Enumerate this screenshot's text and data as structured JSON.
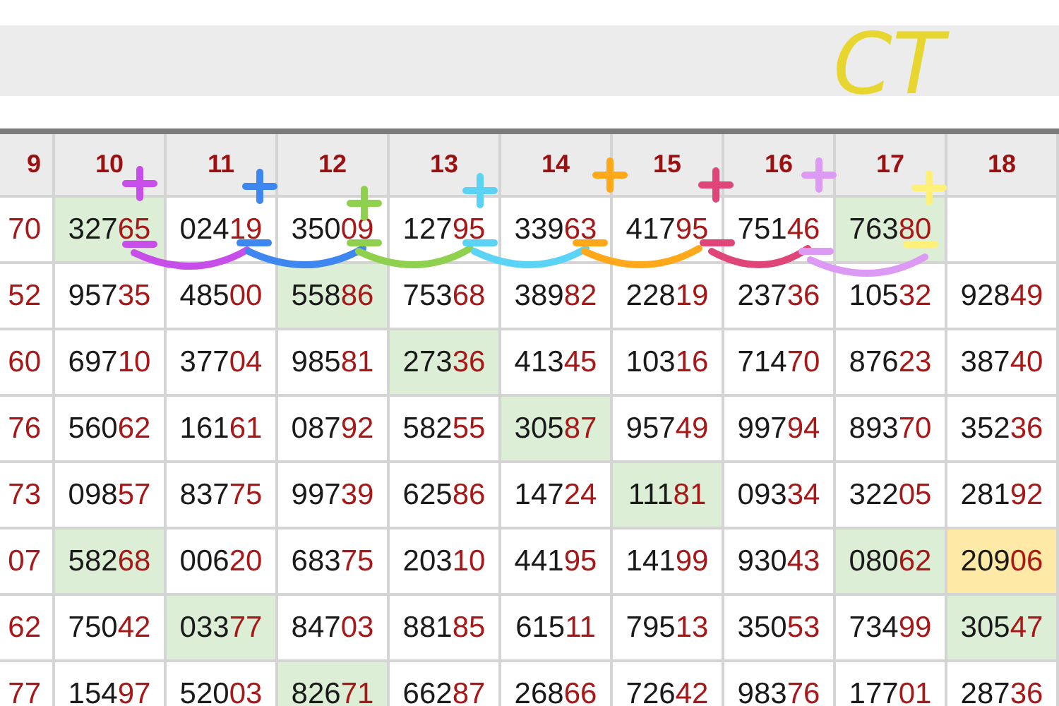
{
  "handwritten_note": "CT",
  "table": {
    "columns": [
      "9",
      "10",
      "11",
      "12",
      "13",
      "14",
      "15",
      "16",
      "17",
      "18"
    ],
    "rows": [
      [
        {
          "text": "70"
        },
        {
          "text": "32765",
          "color": "#dcefd6"
        },
        {
          "text": "02419"
        },
        {
          "text": "35009"
        },
        {
          "text": "12795"
        },
        {
          "text": "33963"
        },
        {
          "text": "41795"
        },
        {
          "text": "75146"
        },
        {
          "text": "76380",
          "color": "#dcefd6"
        }
      ],
      [
        {
          "text": "52"
        },
        {
          "text": "95735"
        },
        {
          "text": "48500"
        },
        {
          "text": "55886",
          "color": "#dcefd6"
        },
        {
          "text": "75368"
        },
        {
          "text": "38982"
        },
        {
          "text": "22819"
        },
        {
          "text": "23736"
        },
        {
          "text": "10532"
        },
        {
          "text": "92849"
        }
      ],
      [
        {
          "text": "60"
        },
        {
          "text": "69710"
        },
        {
          "text": "37704"
        },
        {
          "text": "98581"
        },
        {
          "text": "27336",
          "color": "#dcefd6"
        },
        {
          "text": "41345"
        },
        {
          "text": "10316"
        },
        {
          "text": "71470"
        },
        {
          "text": "87623"
        },
        {
          "text": "38740"
        }
      ],
      [
        {
          "text": "76"
        },
        {
          "text": "56062"
        },
        {
          "text": "16161"
        },
        {
          "text": "08792"
        },
        {
          "text": "58255"
        },
        {
          "text": "30587",
          "color": "#dcefd6"
        },
        {
          "text": "95749"
        },
        {
          "text": "99794"
        },
        {
          "text": "89370"
        },
        {
          "text": "35236"
        }
      ],
      [
        {
          "text": "73"
        },
        {
          "text": "09857"
        },
        {
          "text": "83775"
        },
        {
          "text": "99739"
        },
        {
          "text": "62586"
        },
        {
          "text": "14724"
        },
        {
          "text": "11181",
          "color": "#dcefd6"
        },
        {
          "text": "09334"
        },
        {
          "text": "32205"
        },
        {
          "text": "28192"
        }
      ],
      [
        {
          "text": "07"
        },
        {
          "text": "58268",
          "color": "#dcefd6"
        },
        {
          "text": "00620"
        },
        {
          "text": "68375"
        },
        {
          "text": "20310"
        },
        {
          "text": "44195"
        },
        {
          "text": "14199"
        },
        {
          "text": "93043"
        },
        {
          "text": "08062",
          "color": "#dcefd6"
        },
        {
          "text": "20906",
          "color": "#ffe9a6"
        }
      ],
      [
        {
          "text": "62"
        },
        {
          "text": "75042"
        },
        {
          "text": "03377",
          "color": "#dcefd6"
        },
        {
          "text": "84703"
        },
        {
          "text": "88185"
        },
        {
          "text": "61511"
        },
        {
          "text": "79513"
        },
        {
          "text": "35053"
        },
        {
          "text": "73499"
        },
        {
          "text": "30547",
          "color": "#dcefd6"
        }
      ],
      [
        {
          "text": "77"
        },
        {
          "text": "15497"
        },
        {
          "text": "52003"
        },
        {
          "text": "82671",
          "color": "#dcefd6"
        },
        {
          "text": "66287"
        },
        {
          "text": "26866"
        },
        {
          "text": "72642"
        },
        {
          "text": "98376"
        },
        {
          "text": "17701"
        },
        {
          "text": "28736"
        }
      ]
    ]
  }
}
